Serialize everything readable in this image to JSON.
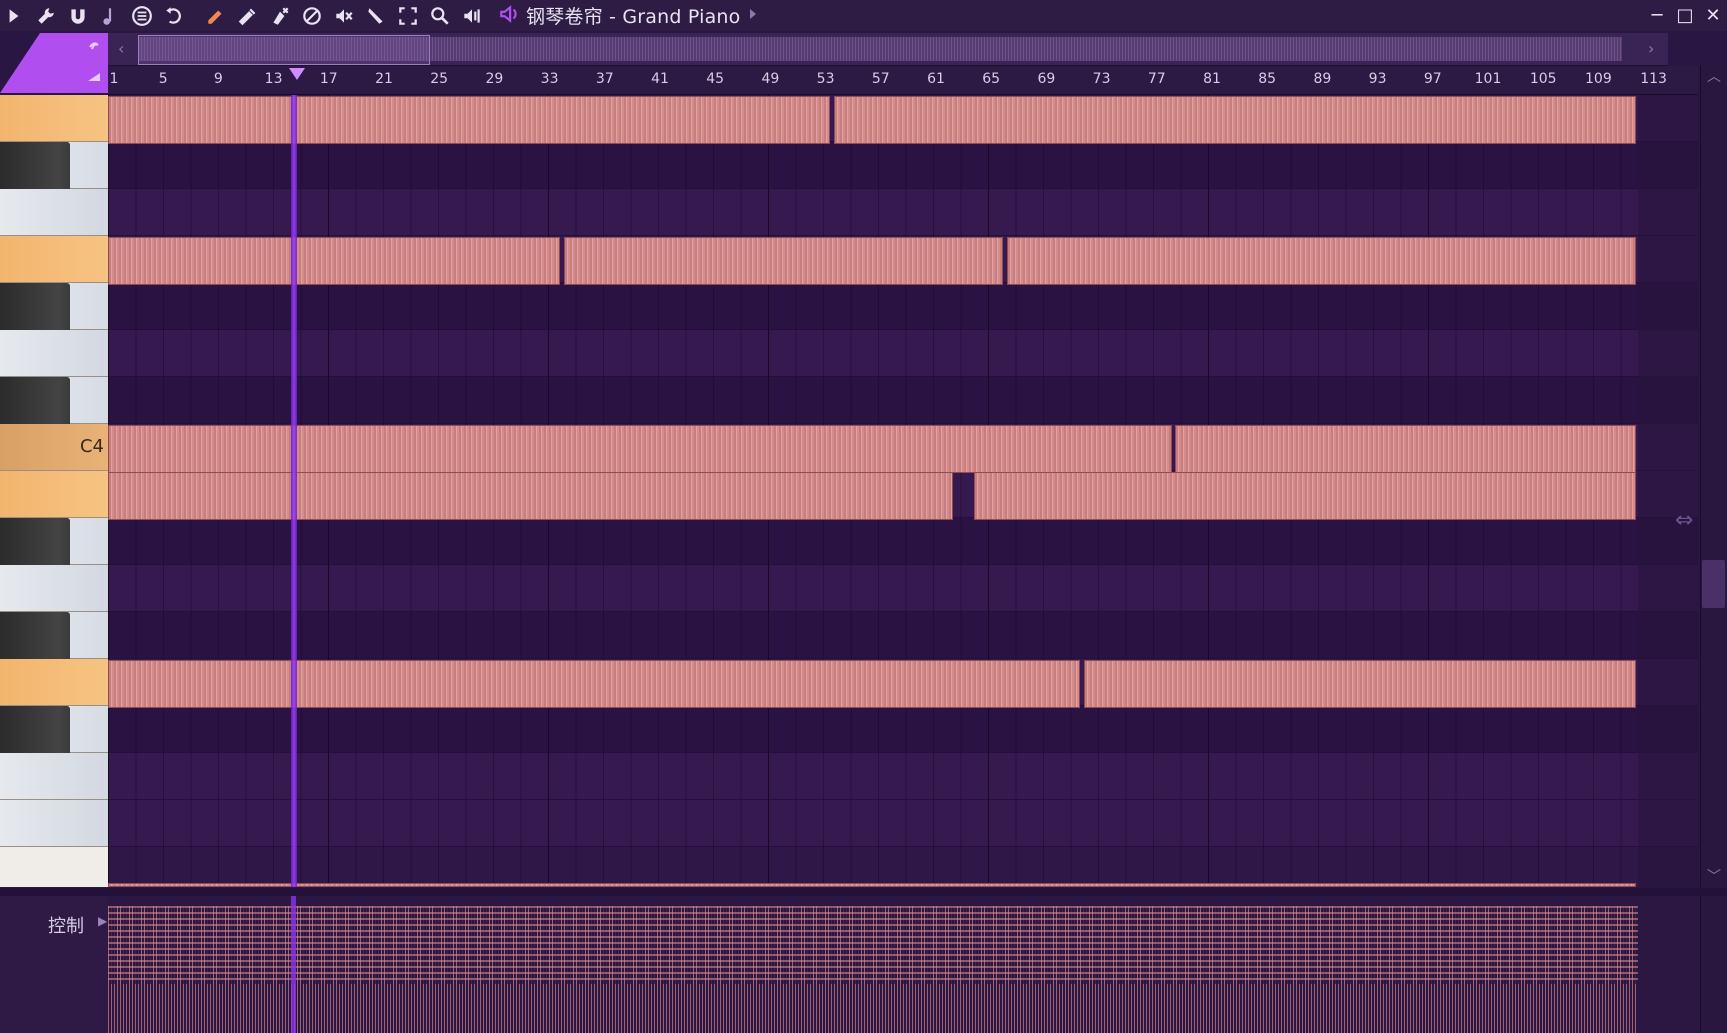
{
  "toolbar": {
    "icons": [
      "play-menu-arrow-icon",
      "wrench-icon",
      "magnet-icon",
      "note-icon",
      "menu-circle-icon",
      "undo-icon",
      "pencil-tool-icon",
      "paint-tool-icon",
      "delete-tool-icon",
      "mute-tool-icon",
      "speaker-mute-icon",
      "slice-tool-icon",
      "select-tool-icon",
      "zoom-tool-icon",
      "playback-tool-icon"
    ],
    "channel_icon": "speaker-icon",
    "title": "钢琴卷帘 - Grand Piano",
    "window_controls": [
      "─",
      "□",
      "✕"
    ]
  },
  "ruler": {
    "bars": [
      "1",
      "5",
      "9",
      "13",
      "17",
      "21",
      "25",
      "29",
      "33",
      "37",
      "41",
      "45",
      "49",
      "53",
      "57",
      "61",
      "65",
      "69",
      "73",
      "77",
      "81",
      "85",
      "89",
      "93",
      "97",
      "101",
      "105",
      "109",
      "113"
    ],
    "playhead_bar": 13.5
  },
  "keyboard": {
    "c4_label": "C4"
  },
  "control_lane": {
    "label": "控制"
  },
  "colors": {
    "background": "#2f1748",
    "note": "#d38c8c",
    "playhead": "#9c40ff",
    "accent": "#b14ef0"
  }
}
